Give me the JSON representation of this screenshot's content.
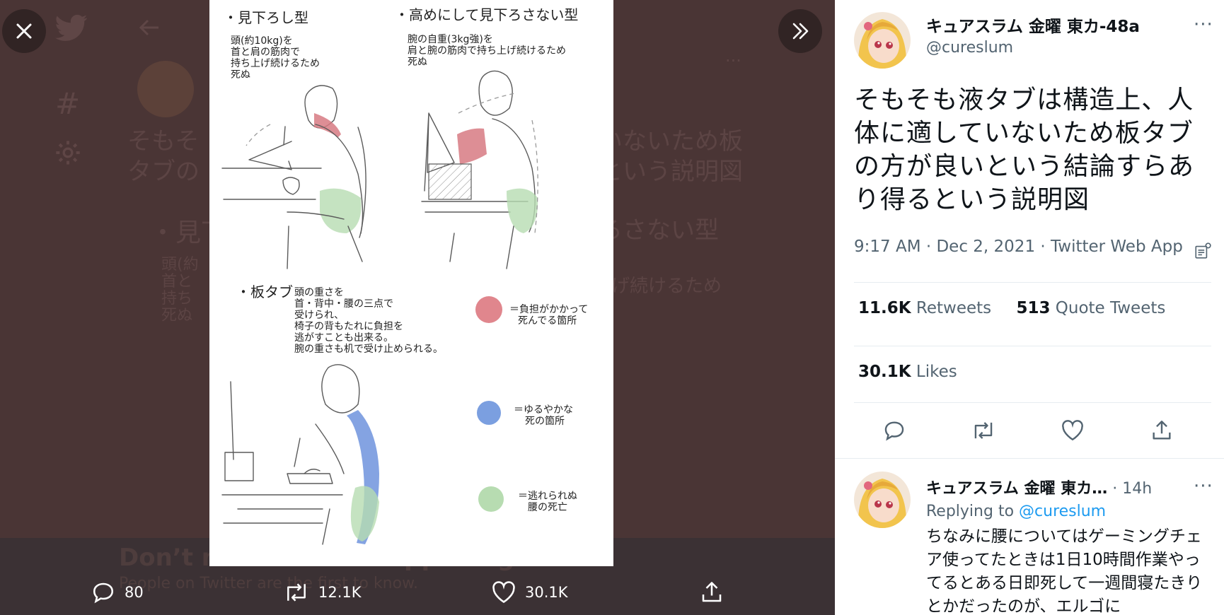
{
  "colors": {
    "accent": "#1d9bf0",
    "text_primary": "#0f1419",
    "text_secondary": "#536471",
    "divider": "#e6ecf0",
    "backdrop": "#4a3535"
  },
  "icons": {
    "close": "close-icon",
    "expand": "expand-icon",
    "reply": "reply-icon",
    "retweet": "retweet-icon",
    "like": "heart-icon",
    "share": "share-icon",
    "more": "more-icon",
    "analytics": "analytics-icon",
    "twitter": "twitter-logo-icon",
    "hashtag": "hashtag-icon",
    "settings": "gear-icon",
    "back": "back-arrow-icon"
  },
  "backdrop": {
    "tweet_text_line1": "そもそ",
    "tweet_text_line1b": "ていないため板",
    "tweet_text_line2": "タブの",
    "tweet_text_line2b": "るという説明図",
    "img_text_1": "・見下",
    "img_text_2": "下ろさない型",
    "img_text_3": "頭(約",
    "img_text_4": "首と",
    "img_text_5": "持ち",
    "img_text_6": "死ぬ",
    "img_text_7": "ち上げ続けるため",
    "banner_title": "Don’t miss what’s happening",
    "banner_subtitle": "People on Twitter are the first to know."
  },
  "media": {
    "label_1": "・見下ろし型",
    "note_1": [
      "頭(約10kg)を",
      "首と肩の筋肉で",
      "持ち上げ続けるため",
      "死ぬ"
    ],
    "label_2": "・高めにして見下ろさない型",
    "note_2": [
      "腕の自重(3kg強)を",
      "肩と腕の筋肉で持ち上げ続けるため",
      "死ぬ"
    ],
    "label_3": "・板タブ",
    "note_3": [
      "頭の重さを",
      "首・背中・腰の三点で",
      "受けられ、",
      "椅子の背もたれに負担を",
      "逃がすことも出来る。",
      "腕の重さも机で受け止められる。"
    ],
    "legend": [
      {
        "color": "#e0868d",
        "lines": [
          "＝負担がかかって",
          "死んでる箇所"
        ]
      },
      {
        "color": "#7b9fe0",
        "lines": [
          "＝ゆるやかな",
          "死の箇所"
        ]
      },
      {
        "color": "#b7dcb1",
        "lines": [
          "＝逃れられぬ",
          "腰の死亡"
        ]
      }
    ]
  },
  "lightbox": {
    "replies": "80",
    "retweets": "12.1K",
    "likes": "30.1K"
  },
  "tweet": {
    "author_name": "キュアスラム 金曜 東カ-48a",
    "author_handle": "@cureslum",
    "text": "そもそも液タブは構造上、人体に適していないため板タブの方が良いという結論すらあり得るという説明図",
    "meta": "9:17 AM · Dec 2, 2021 · Twitter Web App",
    "retweets_count": "11.6K",
    "retweets_label": "Retweets",
    "quotes_count": "513",
    "quotes_label": "Quote Tweets",
    "likes_count": "30.1K",
    "likes_label": "Likes"
  },
  "reply": {
    "author_name": "キュアスラム 金曜 東カ…",
    "time": "· 14h",
    "replying_label": "Replying to",
    "replying_handle": "@cureslum",
    "text": "ちなみに腰についてはゲーミングチェア使ってたときは1日10時間作業やってるとある日即死して一週間寝たきりとかだったのが、エルゴに"
  }
}
